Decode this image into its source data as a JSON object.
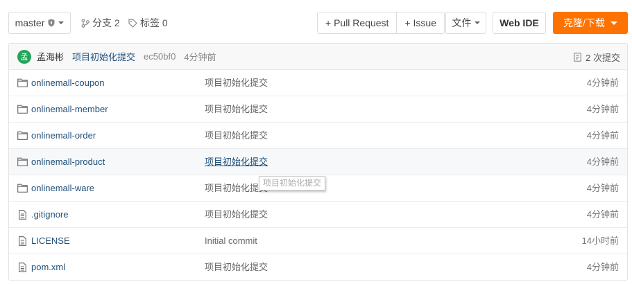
{
  "toolbar": {
    "branch_select": "master",
    "branches_label": "分支 2",
    "tags_label": "标签 0",
    "pull_request_label": "+ Pull Request",
    "issue_label": "+ Issue",
    "file_label": "文件",
    "webide_label": "Web IDE",
    "clone_label": "克隆/下载",
    "clone_color": "#fe7300"
  },
  "latest_commit": {
    "avatar_text": "孟",
    "avatar_color": "#23a55a",
    "author": "孟海彬",
    "message": "项目初始化提交",
    "hash": "ec50bf0",
    "time": "4分钟前",
    "commit_count": "2 次提交"
  },
  "files": [
    {
      "type": "folder",
      "icon": "folder-icon",
      "name": "onlinemall-coupon",
      "message": "项目初始化提交",
      "time": "4分钟前"
    },
    {
      "type": "folder",
      "icon": "folder-icon",
      "name": "onlinemall-member",
      "message": "项目初始化提交",
      "time": "4分钟前"
    },
    {
      "type": "folder",
      "icon": "folder-icon",
      "name": "onlinemall-order",
      "message": "项目初始化提交",
      "time": "4分钟前"
    },
    {
      "type": "folder",
      "icon": "folder-icon",
      "name": "onlinemall-product",
      "message": "项目初始化提交",
      "time": "4分钟前"
    },
    {
      "type": "folder",
      "icon": "folder-icon",
      "name": "onlinemall-ware",
      "message": "项目初始化提交",
      "time": "4分钟前"
    },
    {
      "type": "file",
      "icon": "file-icon",
      "name": ".gitignore",
      "message": "项目初始化提交",
      "time": "4分钟前"
    },
    {
      "type": "file",
      "icon": "file-icon",
      "name": "LICENSE",
      "message": "Initial commit",
      "time": "14小时前"
    },
    {
      "type": "file",
      "icon": "file-icon",
      "name": "pom.xml",
      "message": "项目初始化提交",
      "time": "4分钟前"
    }
  ],
  "tooltip": "项目初始化提交"
}
